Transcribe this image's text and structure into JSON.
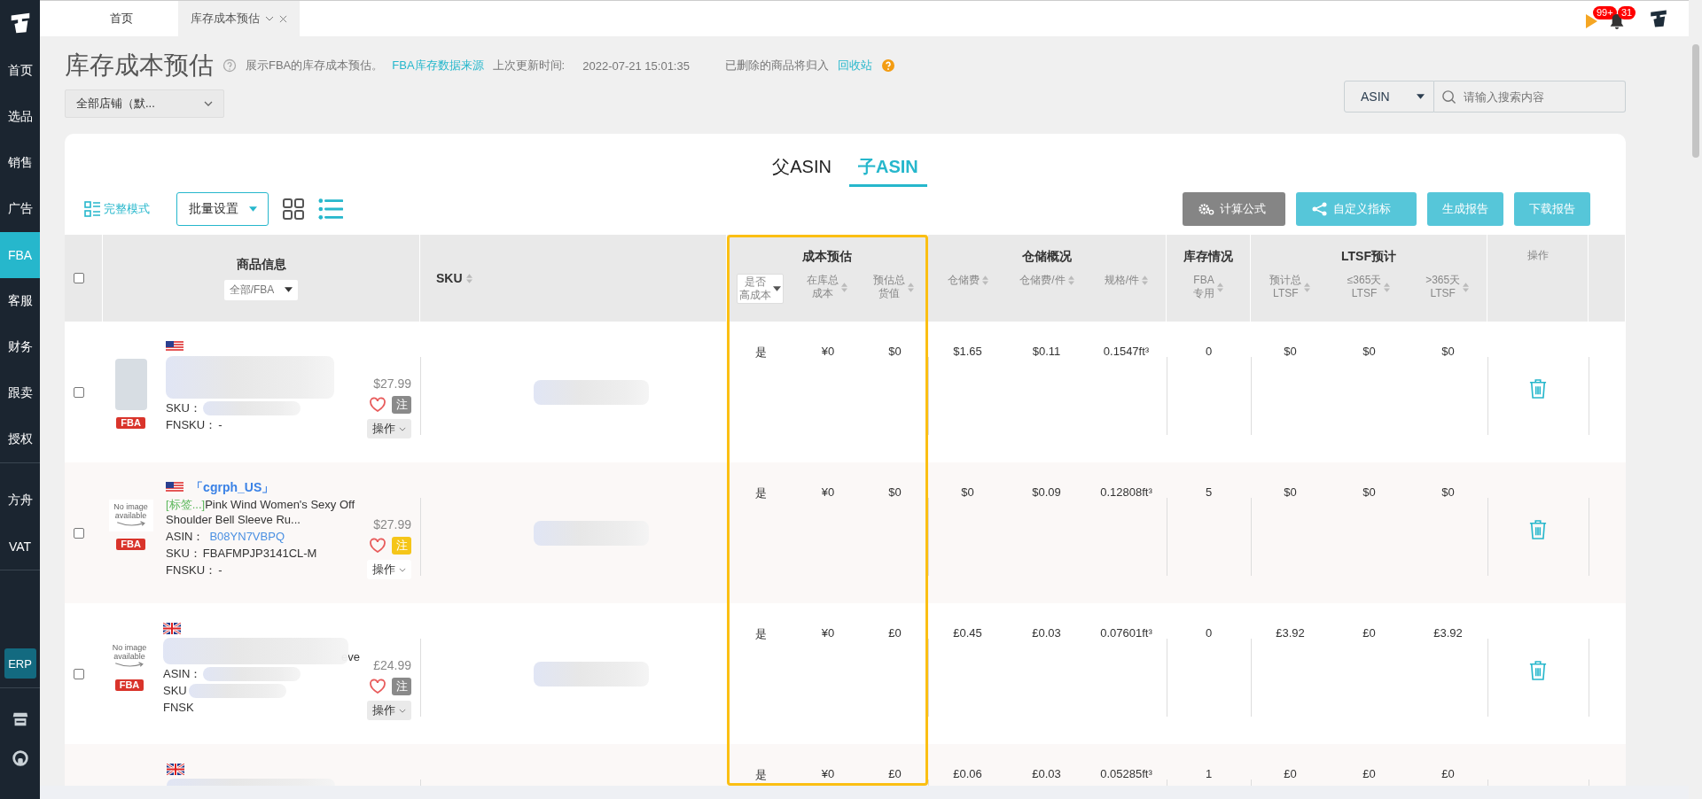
{
  "sidebar": {
    "groups": [
      [
        {
          "label": "首页",
          "selected": false
        },
        {
          "label": "选品",
          "selected": false
        },
        {
          "label": "销售",
          "selected": false
        },
        {
          "label": "广告",
          "selected": false
        },
        {
          "label": "FBA",
          "selected": true
        },
        {
          "label": "客服",
          "selected": false
        },
        {
          "label": "财务",
          "selected": false
        },
        {
          "label": "跟卖",
          "selected": false
        },
        {
          "label": "授权",
          "selected": false
        }
      ],
      [
        {
          "label": "方舟",
          "selected": false
        },
        {
          "label": "VAT",
          "selected": false
        }
      ]
    ],
    "erp": "ERP"
  },
  "tabs": [
    {
      "label": "首页",
      "selected": false,
      "closable": false
    },
    {
      "label": "库存成本预估",
      "selected": true,
      "closable": true
    }
  ],
  "notifications": {
    "flag_badge": "99+",
    "bell_badge": "31"
  },
  "page": {
    "title": "库存成本预估",
    "description": "展示FBA的库存成本预估。",
    "source_link": "FBA库存数据来源",
    "updated_label": "上次更新时间:",
    "updated_time": "2022-07-21 15:01:35",
    "deleted_note": "已删除的商品将归入",
    "recycle_link": "回收站",
    "store_select": "全部店铺（默..."
  },
  "search": {
    "type": "ASIN",
    "placeholder": "请输入搜索内容"
  },
  "view_toggle": [
    {
      "label": "父ASIN",
      "selected": false
    },
    {
      "label": "子ASIN",
      "selected": true
    }
  ],
  "toolbar": {
    "mode": "完整模式",
    "batch": "批量设置",
    "view_modes": [
      {
        "kind": "grid",
        "selected": false
      },
      {
        "kind": "list",
        "selected": true
      }
    ],
    "buttons": [
      {
        "label": "计算公式",
        "kind": "formula"
      },
      {
        "label": "自定义指标",
        "kind": "custom"
      },
      {
        "label": "生成报告",
        "kind": "plain"
      },
      {
        "label": "下载报告",
        "kind": "plain"
      }
    ]
  },
  "table": {
    "header": {
      "select_all": false,
      "product": {
        "title": "商品信息",
        "filter": "全部/FBA"
      },
      "sku": {
        "title": "SKU"
      },
      "groups": [
        {
          "title": "成本预估",
          "highlighted": true,
          "columns": [
            {
              "lines": [
                "是否",
                "高成本"
              ],
              "kind": "select"
            },
            {
              "lines": [
                "在库总",
                "成本"
              ],
              "kind": "sort"
            },
            {
              "lines": [
                "预估总",
                "货值"
              ],
              "kind": "sort"
            }
          ]
        },
        {
          "title": "仓储概况",
          "highlighted": false,
          "columns": [
            {
              "lines": [
                "仓储费"
              ],
              "kind": "sort"
            },
            {
              "lines": [
                "仓储费/件"
              ],
              "kind": "sort"
            },
            {
              "lines": [
                "规格/件"
              ],
              "kind": "sort"
            }
          ]
        },
        {
          "title": "库存情况",
          "highlighted": false,
          "columns": [
            {
              "lines": [
                "FBA",
                "专用"
              ],
              "kind": "sort"
            }
          ]
        },
        {
          "title": "LTSF预计",
          "highlighted": false,
          "columns": [
            {
              "lines": [
                "预计总",
                "LTSF"
              ],
              "kind": "sort"
            },
            {
              "lines": [
                "≤365天",
                "LTSF"
              ],
              "kind": "sort"
            },
            {
              "lines": [
                ">365天",
                "LTSF"
              ],
              "kind": "sort"
            }
          ]
        },
        {
          "highlighted": false,
          "columns": [
            {
              "lines": [
                "操作"
              ],
              "kind": "plain"
            }
          ]
        }
      ]
    },
    "rows": [
      {
        "checked": false,
        "flag": {
          "kind": "us"
        },
        "image": {
          "kind": "photo"
        },
        "fba": "FBA",
        "blurred": true,
        "price": "$27.99",
        "note": {
          "label": "注",
          "color": "#8a8a8a"
        },
        "ops": "操作",
        "fields": [
          {
            "label": "SKU：",
            "blurred": true
          },
          {
            "label": "FNSKU：",
            "value": "-"
          }
        ],
        "sku_blur": true,
        "values": [
          "是",
          "¥0",
          "$0",
          "$1.65",
          "$0.11",
          "0.1547ft³",
          "0",
          "$0",
          "$0",
          "$0"
        ],
        "deletable": true
      },
      {
        "checked": false,
        "flag": {
          "kind": "us"
        },
        "image": {
          "kind": "none",
          "text": "No image available"
        },
        "fba": "FBA",
        "store": "「cgrph_US」",
        "tag": "[标签...]",
        "title": "Pink Wind Women's Sexy Off Shoulder Bell Sleeve Ru...",
        "price": "$27.99",
        "note": {
          "label": "注",
          "color": "#f5c518"
        },
        "ops": "操作",
        "fields": [
          {
            "label": "ASIN：",
            "value": "B08YN7VBPQ",
            "link": true
          },
          {
            "label": "SKU：",
            "value": "FBAFMPJP3141CL-M"
          },
          {
            "label": "FNSKU：",
            "value": "-"
          }
        ],
        "sku_blur": true,
        "values": [
          "是",
          "¥0",
          "$0",
          "$0",
          "$0.09",
          "0.12808ft³",
          "5",
          "$0",
          "$0",
          "$0"
        ],
        "deletable": true
      },
      {
        "checked": false,
        "flag": {
          "kind": "uk"
        },
        "image": {
          "kind": "none",
          "text": "No image available"
        },
        "fba": "FBA",
        "title_blurred": true,
        "title": "eve",
        "price": "£24.99",
        "note": {
          "label": "注",
          "color": "#8a8a8a"
        },
        "ops": "操作",
        "fields": [
          {
            "label": "ASIN：",
            "blurred": true
          },
          {
            "label": "SKU",
            "blurred": true
          },
          {
            "label": "FNSK"
          }
        ],
        "sku_blur": true,
        "values": [
          "是",
          "¥0",
          "£0",
          "£0.45",
          "£0.03",
          "0.07601ft³",
          "0",
          "£3.92",
          "£0",
          "£3.92"
        ],
        "deletable": true
      },
      {
        "flag": {
          "kind": "uk"
        },
        "blurred": true,
        "fields": [],
        "values": [
          "是",
          "¥0",
          "£0",
          "£0.06",
          "£0.03",
          "0.05285ft³",
          "1",
          "£0",
          "£0",
          "£0"
        ]
      }
    ]
  }
}
